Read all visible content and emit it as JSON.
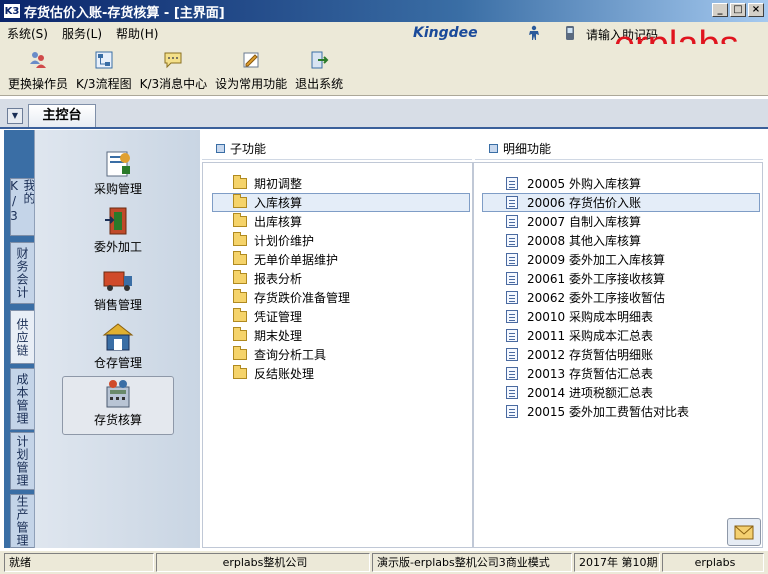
{
  "window": {
    "title": "存货估价入账-存货核算 - [主界面]",
    "app_icon_text": "K3",
    "controls": [
      "_",
      "□",
      "×"
    ]
  },
  "menubar": {
    "items": [
      "系统(S)",
      "服务(L)",
      "帮助(H)"
    ],
    "brand": "Kingdee",
    "search_placeholder": "请输入助记码",
    "watermark": "erplabs",
    "icons": [
      "people-icon",
      "phone-icon"
    ]
  },
  "toolbar": {
    "buttons": [
      {
        "label": "更换操作员",
        "icon": "change-user-icon"
      },
      {
        "label": "K/3流程图",
        "icon": "flowchart-icon"
      },
      {
        "label": "K/3消息中心",
        "icon": "message-icon"
      },
      {
        "label": "设为常用功能",
        "icon": "favorite-icon"
      },
      {
        "label": "退出系统",
        "icon": "exit-icon"
      }
    ]
  },
  "tabstrip": {
    "active_tab": "主控台"
  },
  "leftnav": {
    "tabs": [
      {
        "label": "我的K/3"
      },
      {
        "label": "财务会计"
      },
      {
        "label": "供应链"
      },
      {
        "label": "成本管理"
      },
      {
        "label": "计划管理"
      },
      {
        "label": "生产管理"
      }
    ]
  },
  "modules": {
    "items": [
      {
        "label": "采购管理",
        "icon": "purchase-icon"
      },
      {
        "label": "委外加工",
        "icon": "outsourcing-icon"
      },
      {
        "label": "销售管理",
        "icon": "sales-icon"
      },
      {
        "label": "仓存管理",
        "icon": "warehouse-icon"
      },
      {
        "label": "存货核算",
        "icon": "inventory-accounting-icon"
      }
    ],
    "selected": "存货核算"
  },
  "subfunctions": {
    "header": "子功能",
    "items": [
      "期初调整",
      "入库核算",
      "出库核算",
      "计划价维护",
      "无单价单据维护",
      "报表分析",
      "存货跌价准备管理",
      "凭证管理",
      "期末处理",
      "查询分析工具",
      "反结账处理"
    ],
    "selected": "入库核算"
  },
  "details": {
    "header": "明细功能",
    "items": [
      {
        "code": "20005",
        "label": "外购入库核算"
      },
      {
        "code": "20006",
        "label": "存货估价入账"
      },
      {
        "code": "20007",
        "label": "自制入库核算"
      },
      {
        "code": "20008",
        "label": "其他入库核算"
      },
      {
        "code": "20009",
        "label": "委外加工入库核算"
      },
      {
        "code": "20061",
        "label": "委外工序接收核算"
      },
      {
        "code": "20062",
        "label": "委外工序接收暂估"
      },
      {
        "code": "20010",
        "label": "采购成本明细表"
      },
      {
        "code": "20011",
        "label": "采购成本汇总表"
      },
      {
        "code": "20012",
        "label": "存货暂估明细账"
      },
      {
        "code": "20013",
        "label": "存货暂估汇总表"
      },
      {
        "code": "20014",
        "label": "进项税额汇总表"
      },
      {
        "code": "20015",
        "label": "委外加工费暂估对比表"
      }
    ],
    "selected": "20006"
  },
  "statusbar": {
    "status": "就绪",
    "company": "erplabs整机公司",
    "account": "演示版-erplabs整机公司3商业模式",
    "period": "2017年 第10期",
    "user": "erplabs"
  }
}
